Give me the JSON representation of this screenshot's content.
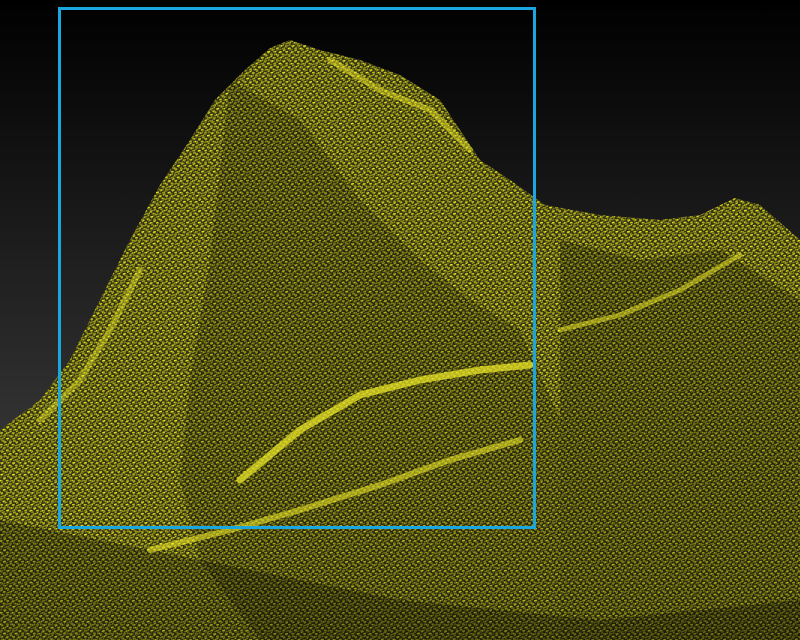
{
  "view": {
    "type": "point-cloud-terrain",
    "background_top": "#000000",
    "background_bottom": "#4a4a4a",
    "point_color": "#e6e21a",
    "point_shadow_color": "#6b6a10",
    "selection_color": "#1aa6df"
  },
  "selection": {
    "visible": true,
    "mode": "rectangle"
  }
}
